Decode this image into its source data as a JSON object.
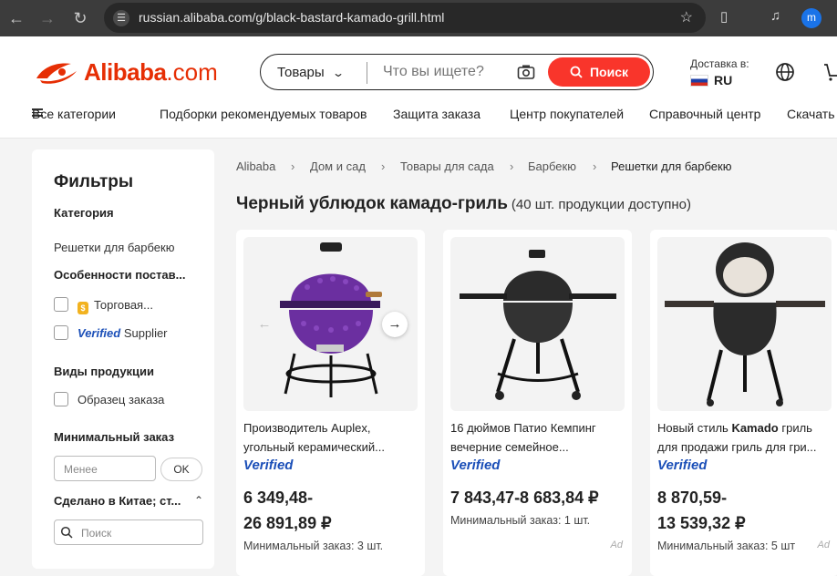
{
  "browser": {
    "url": "russian.alibaba.com/g/black-bastard-kamado-grill.html",
    "profile_initial": "m"
  },
  "header": {
    "brand": "Alibaba",
    "brand_suffix": ".com",
    "search": {
      "category": "Товары",
      "placeholder": "Что вы ищете?",
      "button": "Поиск"
    },
    "delivery": {
      "label": "Доставка в:",
      "country": "RU"
    }
  },
  "menu": {
    "all_categories": "Все категории",
    "items": [
      "Подборки рекомендуемых товаров",
      "Защита заказа",
      "Центр покупателей",
      "Справочный центр",
      "Скачать"
    ]
  },
  "filters": {
    "title": "Фильтры",
    "category_heading": "Категория",
    "category_value": "Решетки для барбекю",
    "supplier_heading": "Особенности постав...",
    "supplier_options": [
      {
        "label": "Торговая...",
        "icon": "trade-assurance-icon"
      },
      {
        "label_verified": "Verified",
        "label": " Supplier"
      }
    ],
    "product_type_heading": "Виды продукции",
    "product_type_options": [
      "Образец заказа"
    ],
    "moq_heading": "Минимальный заказ",
    "moq_placeholder": "Менее",
    "moq_button": "OK",
    "origin_heading": "Сделано в Китае; ст...",
    "origin_search_placeholder": "Поиск"
  },
  "breadcrumb": [
    "Alibaba",
    "Дом и сад",
    "Товары для сада",
    "Барбекю",
    "Решетки для барбекю"
  ],
  "page": {
    "title": "Черный ублюдок камадо-гриль",
    "count": "(40 шт. продукции доступно)"
  },
  "products": [
    {
      "name": "Производитель Auplex, угольный керамический...",
      "verified": "Verified",
      "price_line1": "6 349,48-",
      "price_line2": "26 891,89 ₽",
      "moq": "Минимальный заказ: 3 шт.",
      "ad": "",
      "color": "#6b2fa0"
    },
    {
      "name": "16 дюймов Патио Кемпинг вечерние семейное...",
      "verified": "Verified",
      "price_line1": "7 843,47-8 683,84 ₽",
      "price_line2": "",
      "moq": "Минимальный заказ: 1 шт.",
      "ad": "Ad",
      "color": "#2b2b2b"
    },
    {
      "name_pre": "Новый стиль ",
      "name_bold": "Kamado",
      "name_post": " гриль для продажи гриль для гри...",
      "verified": "Verified",
      "price_line1": "8 870,59-",
      "price_line2": "13 539,32 ₽",
      "moq": "Минимальный заказ: 5 шт",
      "ad": "Ad",
      "color": "#2b2b2b"
    }
  ],
  "colors": {
    "accent": "#f9352b",
    "brand": "#e62e04",
    "verified": "#1b4fb8"
  }
}
